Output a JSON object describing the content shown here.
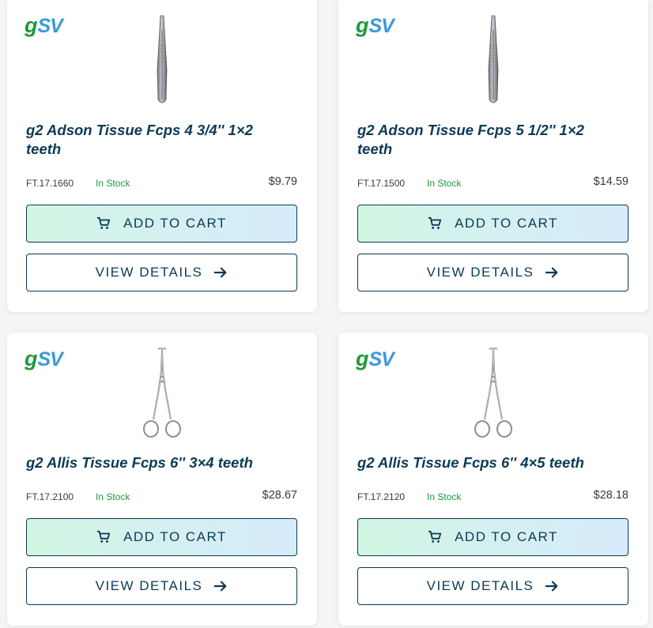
{
  "products": [
    {
      "logo_g": "g",
      "logo_sv": "SV",
      "image": "adson-forceps",
      "title": "g2 Adson Tissue Fcps 4 3/4'' 1×2 teeth",
      "sku": "FT.17.1660",
      "stock": "In Stock",
      "price": "$9.79",
      "add_label": "ADD TO CART",
      "details_label": "VIEW DETAILS"
    },
    {
      "logo_g": "g",
      "logo_sv": "SV",
      "image": "adson-forceps",
      "title": "g2 Adson Tissue Fcps 5 1/2'' 1×2 teeth",
      "sku": "FT.17.1500",
      "stock": "In Stock",
      "price": "$14.59",
      "add_label": "ADD TO CART",
      "details_label": "VIEW DETAILS"
    },
    {
      "logo_g": "g",
      "logo_sv": "SV",
      "image": "allis-forceps",
      "title": "g2 Allis Tissue Fcps 6'' 3×4 teeth",
      "sku": "FT.17.2100",
      "stock": "In Stock",
      "price": "$28.67",
      "add_label": "ADD TO CART",
      "details_label": "VIEW DETAILS"
    },
    {
      "logo_g": "g",
      "logo_sv": "SV",
      "image": "allis-forceps",
      "title": "g2 Allis Tissue Fcps 6'' 4×5 teeth",
      "sku": "FT.17.2120",
      "stock": "In Stock",
      "price": "$28.18",
      "add_label": "ADD TO CART",
      "details_label": "VIEW DETAILS"
    }
  ],
  "colors": {
    "accent": "#0b3a56",
    "stock": "#1f9a3a",
    "logo_green": "#1f9a3a",
    "logo_blue": "#3a9ad9"
  },
  "icons": {
    "cart": "cart-icon",
    "arrow": "arrow-right-icon"
  }
}
